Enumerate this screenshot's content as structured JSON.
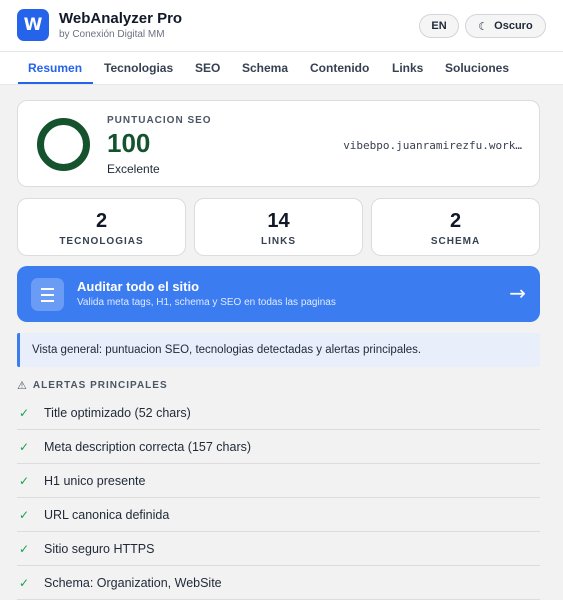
{
  "header": {
    "logo_letter": "W",
    "title": "WebAnalyzer Pro",
    "subtitle": "by Conexión Digital MM",
    "lang_button": "EN",
    "theme_button": "Oscuro",
    "theme_icon": "moon-icon"
  },
  "tabs": [
    {
      "label": "Resumen",
      "active": true
    },
    {
      "label": "Tecnologias"
    },
    {
      "label": "SEO"
    },
    {
      "label": "Schema"
    },
    {
      "label": "Contenido"
    },
    {
      "label": "Links"
    },
    {
      "label": "Soluciones"
    }
  ],
  "score": {
    "label": "PUNTUACION SEO",
    "value": "100",
    "rating": "Excelente",
    "domain": "vibebpo.juanramirezfu.work…",
    "ring_color": "#14532d",
    "fill_percent": 100
  },
  "stats": [
    {
      "value": "2",
      "label": "TECNOLOGIAS"
    },
    {
      "value": "14",
      "label": "LINKS"
    },
    {
      "value": "2",
      "label": "SCHEMA"
    }
  ],
  "audit": {
    "title": "Auditar todo el sitio",
    "subtitle": "Valida meta tags, H1, schema y SEO en todas las paginas",
    "icon": "menu-icon",
    "arrow": "→",
    "color": "#3b7cf0"
  },
  "info": {
    "text": "Vista general: puntuacion SEO, tecnologias detectadas y alertas principales."
  },
  "alerts": {
    "title": "ALERTAS PRINCIPALES",
    "icon": "warning-icon",
    "items": [
      "Title optimizado (52 chars)",
      "Meta description correcta (157 chars)",
      "H1 unico presente",
      "URL canonica definida",
      "Sitio seguro HTTPS",
      "Schema: Organization, WebSite"
    ]
  }
}
